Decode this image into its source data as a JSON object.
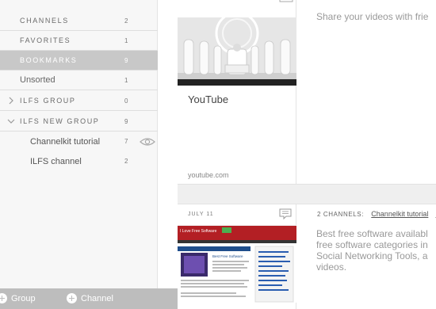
{
  "sidebar": {
    "sections": [
      {
        "label": "CHANNELS",
        "count": "2"
      },
      {
        "label": "FAVORITES",
        "count": "1"
      },
      {
        "label": "BOOKMARKS",
        "count": "9"
      },
      {
        "label": "Unsorted",
        "count": "1"
      },
      {
        "label": "ILFS GROUP",
        "count": "0"
      },
      {
        "label": "ILFS NEW GROUP",
        "count": "9"
      }
    ],
    "children": [
      {
        "label": "Channelkit tutorial",
        "count": "7"
      },
      {
        "label": "ILFS channel",
        "count": "2"
      }
    ],
    "footer": {
      "add_group_label": "Group",
      "add_channel_label": "Channel"
    }
  },
  "feed": {
    "item1": {
      "title": "YouTube",
      "domain": "youtube.com",
      "description": "Share your videos with frie"
    },
    "item2": {
      "date": "JULY 11",
      "channels_count_label": "2 CHANNELS:",
      "channel_link": "Channelkit tutorial",
      "channel_link_2": "I",
      "description_lines": [
        "Best free software availabl",
        "free software categories in",
        "Social Networking Tools, a",
        "videos."
      ],
      "thumb_site_name": "I Love Free Software",
      "thumb_headline": "Best Free Software"
    }
  },
  "colors": {
    "active_row": "#c8c8c8",
    "footer": "#bdbdbd",
    "sidebar_bg": "#f7f7f7",
    "thumb_red": "#c0272d"
  }
}
